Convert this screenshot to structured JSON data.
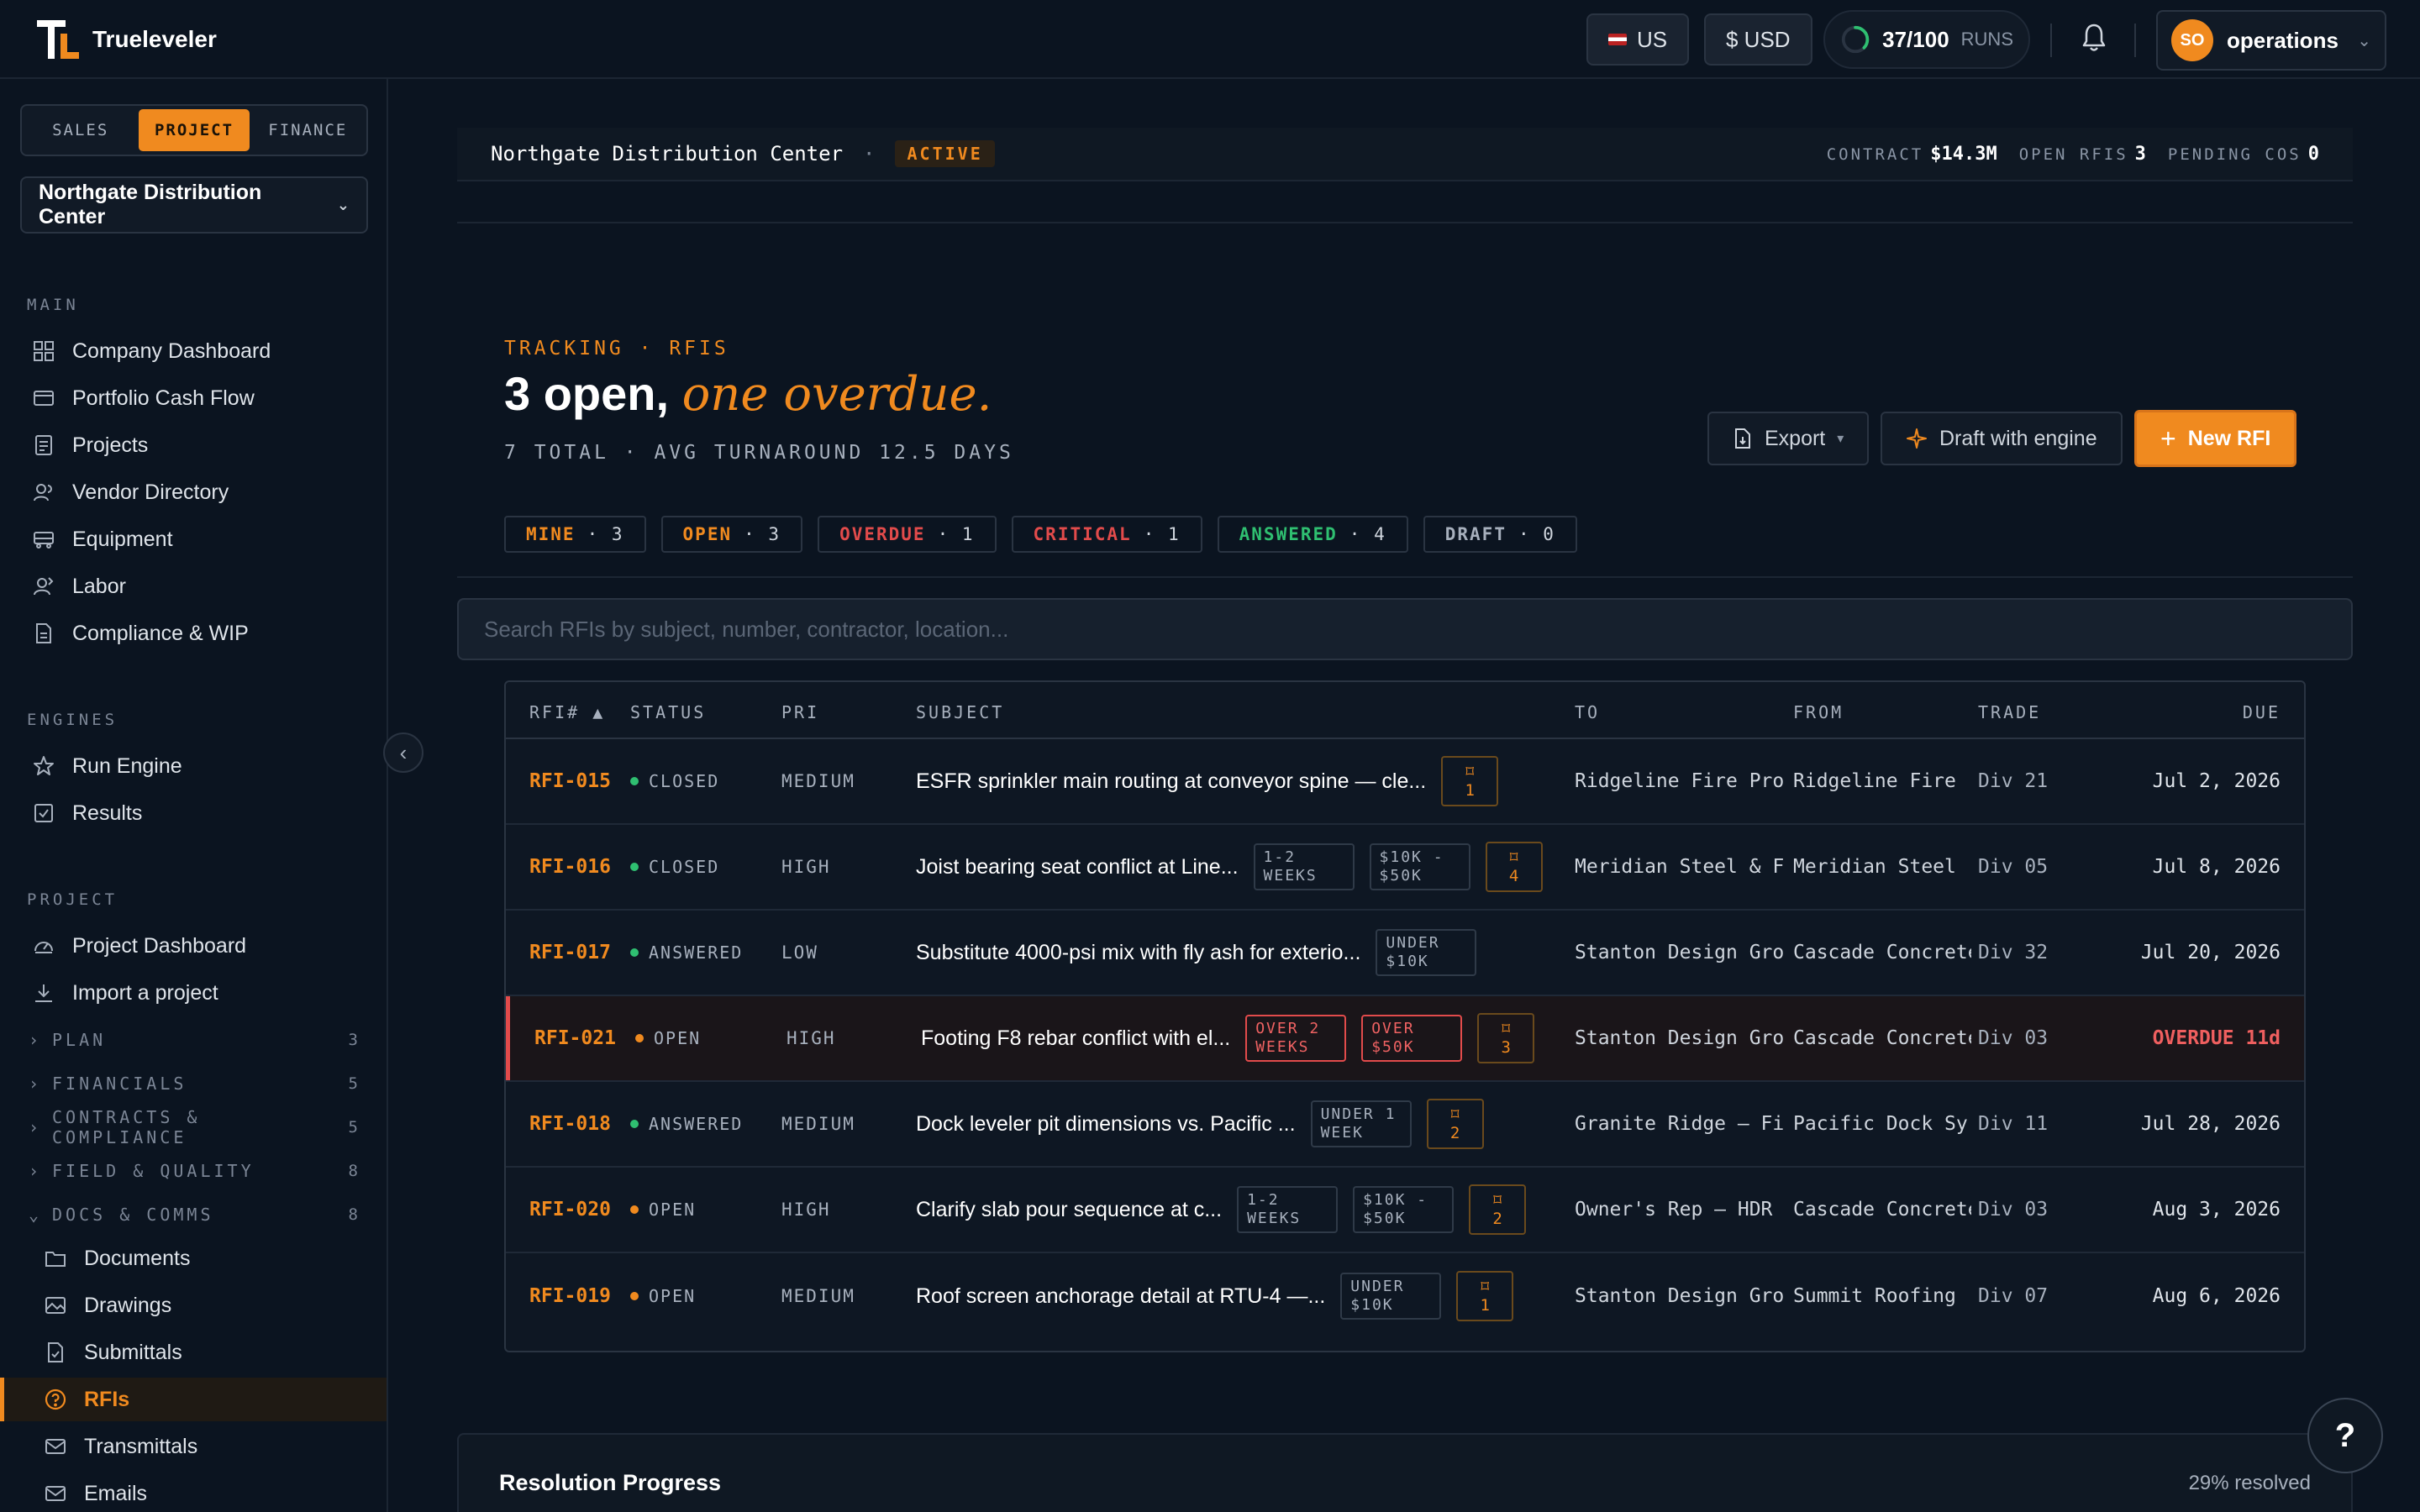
{
  "app": {
    "name": "Trueleveler"
  },
  "topbar": {
    "region": "US",
    "currency": "$ USD",
    "runs_count": "37/100",
    "runs_label": "RUNS",
    "runs_progress": 0.37,
    "user_initials": "SO",
    "user_name": "operations"
  },
  "sidebar": {
    "segments": [
      "SALES",
      "PROJECT",
      "FINANCE"
    ],
    "active_segment": "PROJECT",
    "project": "Northgate Distribution Center",
    "main_label": "MAIN",
    "main_items": [
      "Company Dashboard",
      "Portfolio Cash Flow",
      "Projects",
      "Vendor Directory",
      "Equipment",
      "Labor",
      "Compliance & WIP"
    ],
    "engines_label": "ENGINES",
    "engine_items": [
      "Run Engine",
      "Results"
    ],
    "project_label": "PROJECT",
    "project_items": [
      "Project Dashboard",
      "Import a project"
    ],
    "groups": [
      {
        "name": "PLAN",
        "count": "3"
      },
      {
        "name": "FINANCIALS",
        "count": "5"
      },
      {
        "name": "CONTRACTS & COMPLIANCE",
        "count": "5"
      },
      {
        "name": "FIELD & QUALITY",
        "count": "8"
      },
      {
        "name": "DOCS & COMMS",
        "count": "8"
      }
    ],
    "docs_items": [
      "Documents",
      "Drawings",
      "Submittals",
      "RFIs",
      "Transmittals",
      "Emails"
    ],
    "active_item": "RFIs"
  },
  "projbar": {
    "name": "Northgate Distribution Center",
    "status": "ACTIVE",
    "contract_label": "CONTRACT",
    "contract_value": "$14.3M",
    "rfis_label": "OPEN RFIS",
    "rfis_value": "3",
    "cos_label": "PENDING COS",
    "cos_value": "0"
  },
  "header": {
    "kicker": "TRACKING · RFIS",
    "title": "3 open,",
    "title_accent": "one overdue.",
    "subtitle": "7 TOTAL · AVG TURNAROUND 12.5 DAYS",
    "export_label": "Export",
    "draft_label": "Draft with engine",
    "new_label": "New RFI"
  },
  "filters": [
    {
      "label": "MINE",
      "count": "3",
      "color": "#f08a1f"
    },
    {
      "label": "OPEN",
      "count": "3",
      "color": "#f08a1f"
    },
    {
      "label": "OVERDUE",
      "count": "1",
      "color": "#e24b4b"
    },
    {
      "label": "CRITICAL",
      "count": "1",
      "color": "#e24b4b"
    },
    {
      "label": "ANSWERED",
      "count": "4",
      "color": "#2fbf71"
    },
    {
      "label": "DRAFT",
      "count": "0",
      "color": "#a7b0bd"
    }
  ],
  "search": {
    "placeholder": "Search RFIs by subject, number, contractor, location..."
  },
  "table": {
    "columns": [
      "RFI# ▲",
      "STATUS",
      "PRI",
      "SUBJECT",
      "TO",
      "FROM",
      "TRADE",
      "DUE"
    ],
    "rows": [
      {
        "id": "RFI-015",
        "status": "CLOSED",
        "status_color": "#2fbf71",
        "pri": "MEDIUM",
        "subject": "ESFR sprinkler main routing at conveyor spine — cle...",
        "tags": [],
        "bookmarks": "1",
        "to": "Ridgeline Fire Pro...",
        "from": "Ridgeline Fire ...",
        "trade": "Div 21",
        "due": "Jul 2, 2026",
        "overdue": false
      },
      {
        "id": "RFI-016",
        "status": "CLOSED",
        "status_color": "#2fbf71",
        "pri": "HIGH",
        "subject": "Joist bearing seat conflict at Line...",
        "tags": [
          {
            "t": "1-2 WEEKS",
            "red": false
          },
          {
            "t": "$10K - $50K",
            "red": false
          }
        ],
        "bookmarks": "4",
        "to": "Meridian Steel & F...",
        "from": "Meridian Steel ...",
        "trade": "Div 05",
        "due": "Jul 8, 2026",
        "overdue": false
      },
      {
        "id": "RFI-017",
        "status": "ANSWERED",
        "status_color": "#2fbf71",
        "pri": "LOW",
        "subject": "Substitute 4000-psi mix with fly ash for exterio...",
        "tags": [
          {
            "t": "UNDER $10K",
            "red": false
          }
        ],
        "bookmarks": "",
        "to": "Stanton Design Gro...",
        "from": "Cascade Concrete",
        "trade": "Div 32",
        "due": "Jul 20, 2026",
        "overdue": false
      },
      {
        "id": "RFI-021",
        "status": "OPEN",
        "status_color": "#f08a1f",
        "pri": "HIGH",
        "subject": "Footing F8 rebar conflict with el...",
        "tags": [
          {
            "t": "OVER 2 WEEKS",
            "red": true
          },
          {
            "t": "OVER $50K",
            "red": true
          }
        ],
        "bookmarks": "3",
        "to": "Stanton Design Gro...",
        "from": "Cascade Concrete",
        "trade": "Div 03",
        "due": "OVERDUE 11d",
        "overdue": true
      },
      {
        "id": "RFI-018",
        "status": "ANSWERED",
        "status_color": "#2fbf71",
        "pri": "MEDIUM",
        "subject": "Dock leveler pit dimensions vs. Pacific ...",
        "tags": [
          {
            "t": "UNDER 1 WEEK",
            "red": false
          }
        ],
        "bookmarks": "2",
        "to": "Granite Ridge — Fi...",
        "from": "Pacific Dock Sy...",
        "trade": "Div 11",
        "due": "Jul 28, 2026",
        "overdue": false
      },
      {
        "id": "RFI-020",
        "status": "OPEN",
        "status_color": "#f08a1f",
        "pri": "HIGH",
        "subject": "Clarify slab pour sequence at c...",
        "tags": [
          {
            "t": "1-2 WEEKS",
            "red": false
          },
          {
            "t": "$10K - $50K",
            "red": false
          }
        ],
        "bookmarks": "2",
        "to": "Owner's Rep — HDR",
        "from": "Cascade Concrete",
        "trade": "Div 03",
        "due": "Aug 3, 2026",
        "overdue": false
      },
      {
        "id": "RFI-019",
        "status": "OPEN",
        "status_color": "#f08a1f",
        "pri": "MEDIUM",
        "subject": "Roof screen anchorage detail at RTU-4 —...",
        "tags": [
          {
            "t": "UNDER $10K",
            "red": false
          }
        ],
        "bookmarks": "1",
        "to": "Stanton Design Gro...",
        "from": "Summit Roofing ...",
        "trade": "Div 07",
        "due": "Aug 6, 2026",
        "overdue": false
      }
    ]
  },
  "resolution": {
    "title": "Resolution Progress",
    "value": "29% resolved"
  },
  "help_label": "?"
}
